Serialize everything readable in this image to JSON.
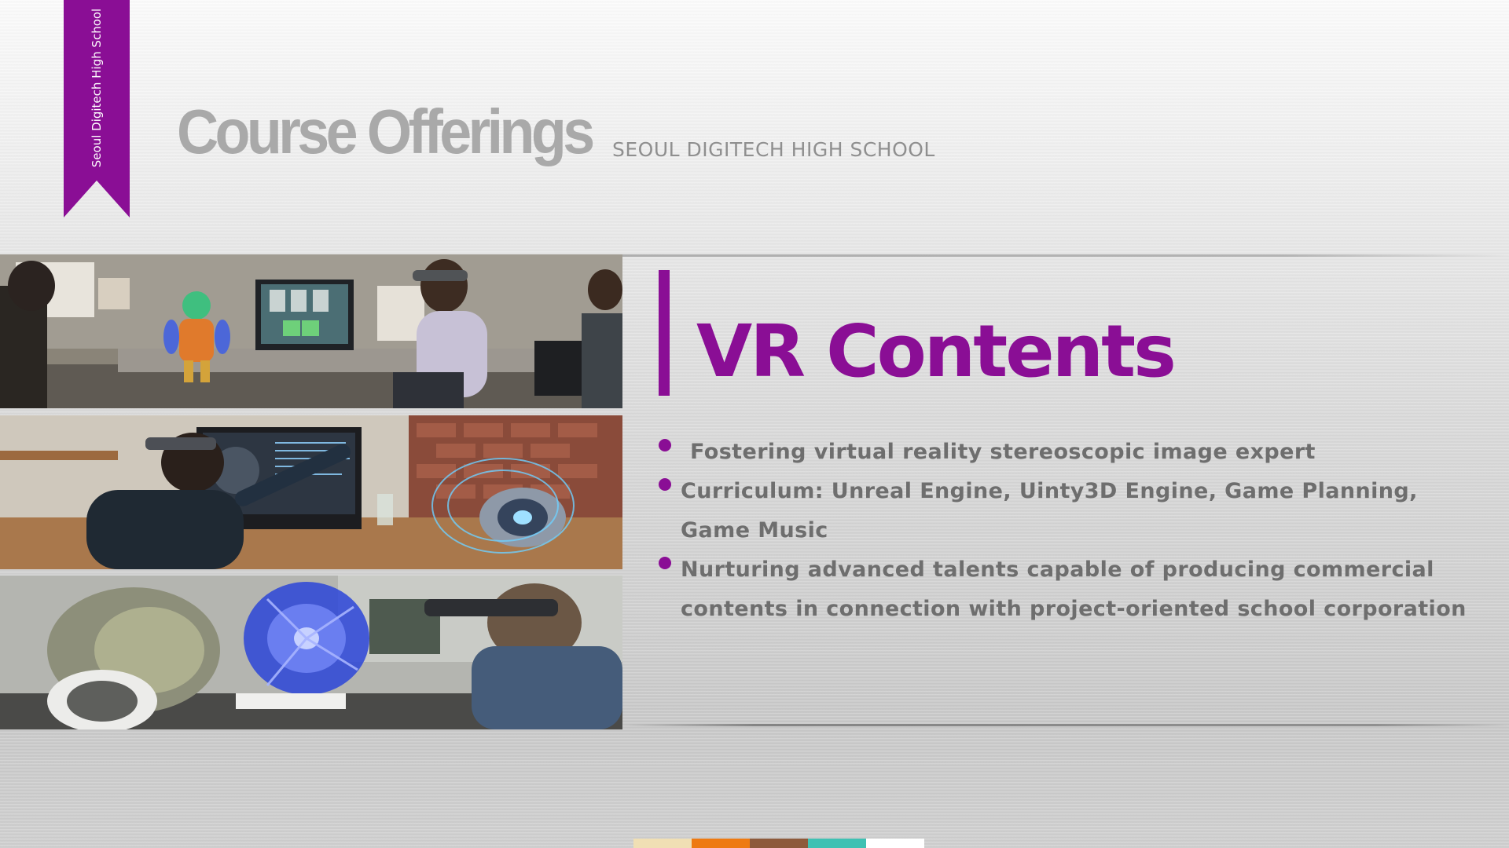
{
  "ribbon": {
    "label": "Seoul Digitech High School"
  },
  "header": {
    "title": "Course Offerings",
    "subtitle": "SEOUL DIGITECH HIGH SCHOOL"
  },
  "section": {
    "heading": "VR Contents",
    "bullets": [
      "Fostering virtual reality stereoscopic image expert",
      "Curriculum: Unreal Engine, Uinty3D Engine, Game Planning, Game Music",
      "Nurturing advanced talents capable of producing commercial contents in connection with project-oriented school corporation"
    ]
  },
  "photos": [
    {
      "name": "mixed-reality-office-photo"
    },
    {
      "name": "hologram-speaker-design-photo"
    },
    {
      "name": "turbine-hologram-photo"
    }
  ],
  "colors": {
    "accent": "#8a0e95",
    "title_gray": "#a9a9a9",
    "body_gray": "#6e6e6e",
    "swatches": [
      "#f0dfb4",
      "#ee7a12",
      "#8d5a3b",
      "#3fc1b3",
      "#ffffff"
    ]
  }
}
